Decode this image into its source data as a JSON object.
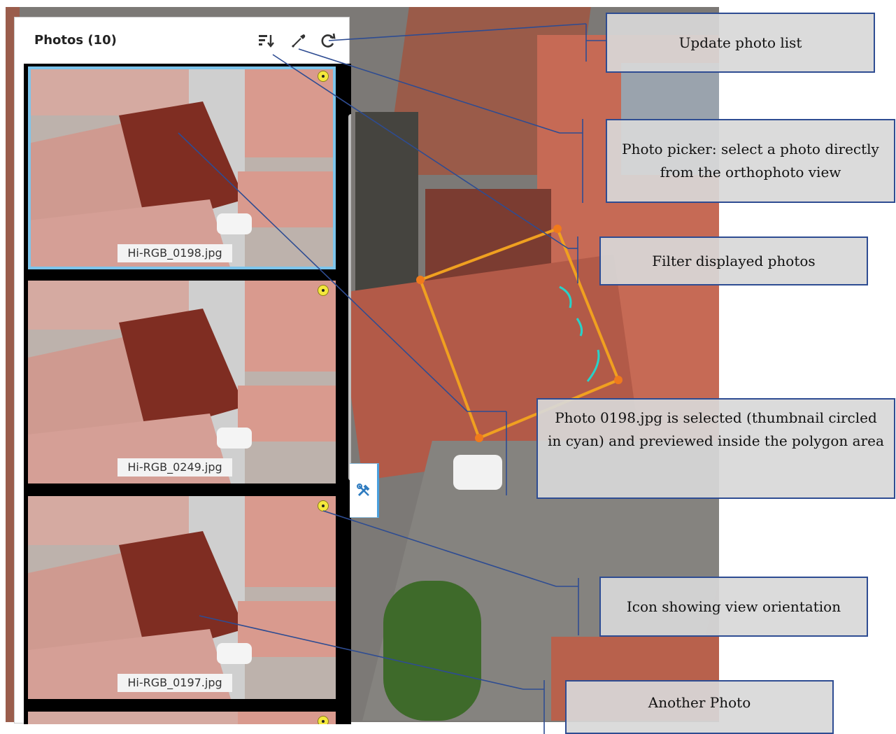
{
  "panel": {
    "title": "Photos (10)",
    "icons": [
      "filter-icon",
      "eyedropper-icon",
      "refresh-icon"
    ],
    "photos": [
      {
        "filename": "Hi-RGB_0198.jpg",
        "selected": true
      },
      {
        "filename": "Hi-RGB_0249.jpg",
        "selected": false
      },
      {
        "filename": "Hi-RGB_0197.jpg",
        "selected": false
      }
    ]
  },
  "tool_tab": {
    "icon": "tools-icon"
  },
  "callouts": {
    "update": "Update photo list",
    "picker": "Photo picker: select a photo directly from the orthophoto view",
    "filter": "Filter displayed photos",
    "selected": "Photo 0198.jpg is selected (thumbnail circled in cyan) and previewed inside the polygon area",
    "orientation": "Icon showing view orientation",
    "another": "Another Photo"
  },
  "colors": {
    "selection_outline": "#7dc5ec",
    "polygon": "#f0a020",
    "callout_border": "#2e4c92",
    "leader_line": "#2e4c92"
  }
}
